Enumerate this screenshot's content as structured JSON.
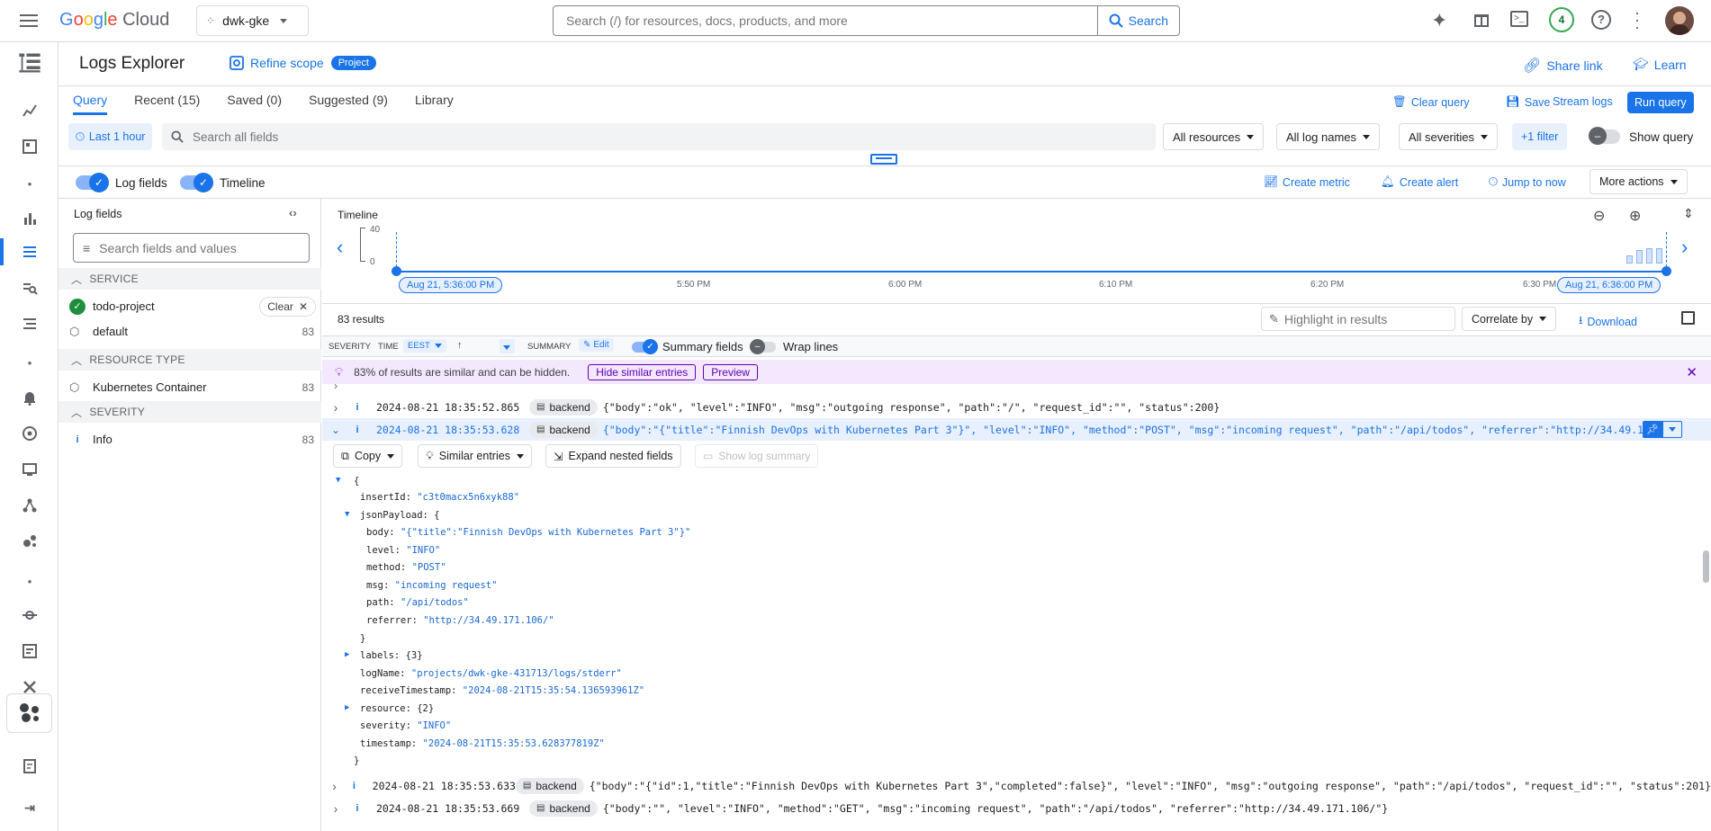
{
  "header": {
    "brand": "Google Cloud",
    "project": "dwk-gke",
    "search_placeholder": "Search (/) for resources, docs, products, and more",
    "search_button": "Search",
    "notifications_count": "4"
  },
  "page": {
    "title": "Logs Explorer",
    "refine_scope": "Refine scope",
    "scope_badge": "Project",
    "share_link": "Share link",
    "learn": "Learn"
  },
  "tabs": [
    "Query",
    "Recent (15)",
    "Saved (0)",
    "Suggested (9)",
    "Library"
  ],
  "query_actions": {
    "clear": "Clear query",
    "save": "Save",
    "stream": "Stream logs",
    "run": "Run query"
  },
  "filters": {
    "time_range": "Last 1 hour",
    "search_placeholder": "Search all fields",
    "resources": "All resources",
    "log_names": "All log names",
    "severities": "All severities",
    "extra_filter": "+1 filter",
    "show_query": "Show query"
  },
  "view_toggles": {
    "log_fields": "Log fields",
    "timeline": "Timeline",
    "create_metric": "Create metric",
    "create_alert": "Create alert",
    "jump_to_now": "Jump to now",
    "more_actions": "More actions"
  },
  "log_fields_panel": {
    "title": "Log fields",
    "search_placeholder": "Search fields and values",
    "sections": [
      {
        "name": "SERVICE"
      },
      {
        "name": "RESOURCE TYPE"
      },
      {
        "name": "SEVERITY"
      }
    ],
    "service_items": [
      {
        "label": "todo-project",
        "action": "Clear"
      },
      {
        "label": "default",
        "count": "83"
      }
    ],
    "resource_items": [
      {
        "label": "Kubernetes Container",
        "count": "83"
      }
    ],
    "severity_items": [
      {
        "label": "Info",
        "count": "83"
      }
    ]
  },
  "timeline": {
    "title": "Timeline",
    "y_max": "40",
    "y_min": "0",
    "start_label": "Aug 21, 5:36:00 PM",
    "end_label": "Aug 21, 6:36:00 PM",
    "ticks": [
      "5:50 PM",
      "6:00 PM",
      "6:10 PM",
      "6:20 PM",
      "6:30 PM"
    ]
  },
  "results": {
    "count": "83 results",
    "highlight_placeholder": "Highlight in results",
    "correlate_by": "Correlate by",
    "download": "Download",
    "col_severity": "SEVERITY",
    "col_time": "TIME",
    "tz": "EEST",
    "col_summary": "SUMMARY",
    "edit": "Edit",
    "summary_fields": "Summary fields",
    "wrap_lines": "Wrap lines",
    "banner_text": "83% of results are similar and can be hidden.",
    "hide_similar": "Hide similar entries",
    "preview": "Preview"
  },
  "log_rows": [
    {
      "time": "2024-08-21 18:35:52.865",
      "service": "backend",
      "summary": "{\"body\":\"ok\", \"level\":\"INFO\", \"msg\":\"outgoing response\", \"path\":\"/\", \"request_id\":\"\", \"status\":200}"
    },
    {
      "time": "2024-08-21 18:35:53.628",
      "service": "backend",
      "summary": "{\"body\":\"{\"title\":\"Finnish DevOps with Kubernetes Part 3\"}\", \"level\":\"INFO\", \"method\":\"POST\", \"msg\":\"incoming request\", \"path\":\"/api/todos\", \"referrer\":\"http://34.49.171.1..."
    },
    {
      "time": "2024-08-21 18:35:53.633",
      "service": "backend",
      "summary": "{\"body\":\"{\"id\":1,\"title\":\"Finnish DevOps with Kubernetes Part 3\",\"completed\":false}\", \"level\":\"INFO\", \"msg\":\"outgoing response\", \"path\":\"/api/todos\", \"request_id\":\"\", \"status\":201}"
    },
    {
      "time": "2024-08-21 18:35:53.669",
      "service": "backend",
      "summary": "{\"body\":\"\", \"level\":\"INFO\", \"method\":\"GET\", \"msg\":\"incoming request\", \"path\":\"/api/todos\", \"referrer\":\"http://34.49.171.106/\"}"
    }
  ],
  "expanded_actions": {
    "copy": "Copy",
    "similar": "Similar entries",
    "expand_nested": "Expand nested fields",
    "show_summary": "Show log summary"
  },
  "expanded_entry": {
    "open_brace": "{",
    "close_brace": "}",
    "insertId_key": "insertId:",
    "insertId": "\"c3t0macx5n6xyk88\"",
    "jsonPayload_key": "jsonPayload: {",
    "body_key": "body:",
    "body": "\"{\"title\":\"Finnish DevOps with Kubernetes Part 3\"}\"",
    "level_key": "level:",
    "level": "\"INFO\"",
    "method_key": "method:",
    "method": "\"POST\"",
    "msg_key": "msg:",
    "msg": "\"incoming request\"",
    "path_key": "path:",
    "path": "\"/api/todos\"",
    "referrer_key": "referrer:",
    "referrer": "\"http://34.49.171.106/\"",
    "inner_close": "}",
    "labels": "labels: {3}",
    "logName_key": "logName:",
    "logName": "\"projects/dwk-gke-431713/logs/stderr\"",
    "receive_key": "receiveTimestamp:",
    "receiveTimestamp": "\"2024-08-21T15:35:54.136593961Z\"",
    "resource": "resource: {2}",
    "severity_key": "severity:",
    "severity": "\"INFO\"",
    "timestamp_key": "timestamp:",
    "timestamp": "\"2024-08-21T15:35:53.628377819Z\""
  },
  "colors": {
    "accent": "#1a73e8",
    "banner_bg": "#f3e8fd",
    "selected_row_bg": "#e8f0fe"
  }
}
